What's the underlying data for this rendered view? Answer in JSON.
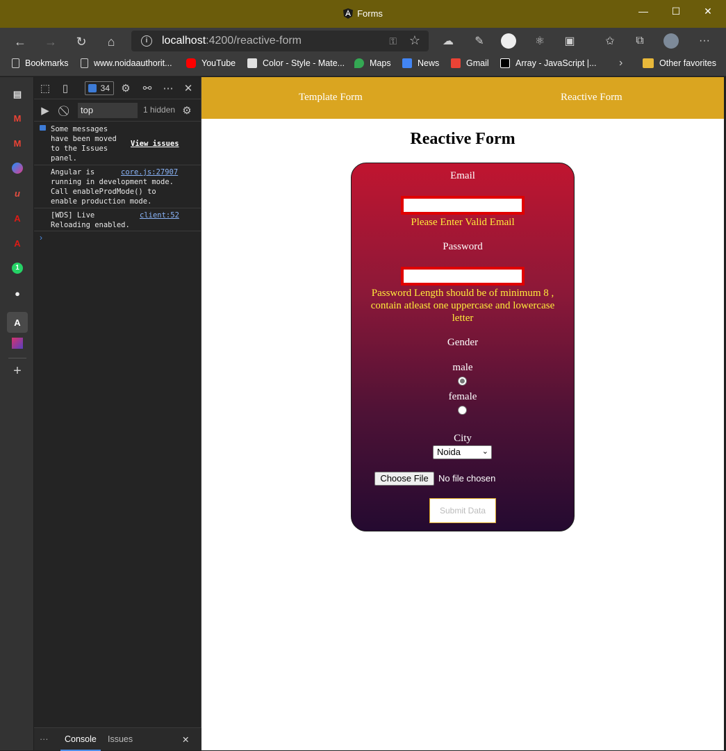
{
  "window": {
    "title": "Forms",
    "minimize": "—",
    "maximize": "☐",
    "close": "✕"
  },
  "nav": {
    "url_host": "localhost",
    "url_path": ":4200/reactive-form"
  },
  "bookmarks": [
    {
      "label": "Bookmarks",
      "color": "#cccccc"
    },
    {
      "label": "www.noidaauthorit...",
      "color": "#cccccc"
    },
    {
      "label": "YouTube",
      "color": "#ff0000"
    },
    {
      "label": "Color - Style - Mate...",
      "color": "#e0e0e0"
    },
    {
      "label": "Maps",
      "color": "#34a853"
    },
    {
      "label": "News",
      "color": "#4285f4"
    },
    {
      "label": "Gmail",
      "color": "#ea4335"
    },
    {
      "label": "Array - JavaScript |...",
      "color": "#ffffff"
    },
    {
      "label": "Other favorites",
      "color": "#e8b83a"
    }
  ],
  "devtools": {
    "issues_count": "34",
    "context": "top",
    "hidden": "1 hidden",
    "messages": [
      {
        "text": "Some messages\nhave been moved\nto the Issues\npanel.",
        "link": "View issues"
      },
      {
        "text": "Angular is\nrunning in development mode.\nCall enableProdMode() to\nenable production mode.",
        "link": "core.js:27907"
      },
      {
        "text": "[WDS] Live\nReloading enabled.",
        "link": "client:52"
      }
    ],
    "prompt": "›",
    "more": "···",
    "tabs": {
      "console": "Console",
      "issues": "Issues"
    },
    "close": "✕"
  },
  "app": {
    "nav": {
      "template_form": "Template Form",
      "reactive_form": "Reactive Form"
    },
    "title": "Reactive Form",
    "form": {
      "email_label": "Email",
      "email_value": "",
      "email_error": "Please Enter Valid Email",
      "password_label": "Password",
      "password_value": "",
      "password_error_1": "Password Length should be of minimum 8 ,",
      "password_error_2": "contain atleast one uppercase and lowercase",
      "password_error_3": "letter",
      "gender_label": "Gender",
      "gender_options": [
        {
          "label": "male",
          "checked": true
        },
        {
          "label": "female",
          "checked": false
        }
      ],
      "city_label": "City",
      "city_value": "Noida",
      "choose_file": "Choose File",
      "no_file": "No file chosen",
      "submit": "Submit Data"
    }
  },
  "colors": {
    "titlebar": "#6b5c0b",
    "app_nav": "#daa520",
    "card_top": "#c01530",
    "card_bottom": "#240a30",
    "error_text": "#ffeb3b",
    "input_border": "#e00000"
  }
}
